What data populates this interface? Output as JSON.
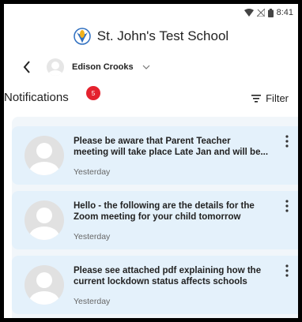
{
  "status_bar": {
    "time": "8:41"
  },
  "school": {
    "name": "St. John's Test School"
  },
  "user": {
    "name": "Edison Crooks"
  },
  "notifications": {
    "title": "Notifications",
    "badge_count": "5",
    "filter_label": "Filter",
    "items": [
      {
        "message": "Please be aware that Parent Teacher\nmeeting will take place Late Jan and will be...",
        "time": "Yesterday"
      },
      {
        "message": "Hello - the following are the details for the\nZoom meeting for your child tomorrow",
        "time": "Yesterday"
      },
      {
        "message": "Please see attached pdf explaining how the\ncurrent lockdown status affects schools",
        "time": "Yesterday"
      }
    ]
  },
  "colors": {
    "card_bg": "#e4f1fb",
    "badge": "#e4222e",
    "logo_blue": "#2f6fc0",
    "logo_yellow": "#f2b21b"
  }
}
